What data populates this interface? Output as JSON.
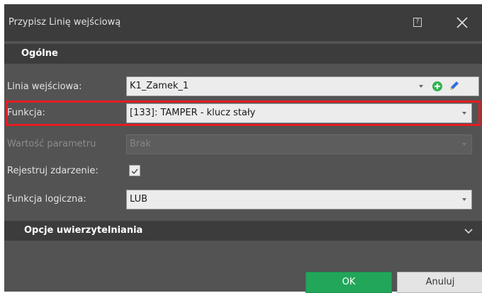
{
  "dialog": {
    "title": "Przypisz Linię wejściową",
    "help_glyph": "?"
  },
  "sections": {
    "general": "Ogólne",
    "auth_options": "Opcje uwierzytelniania"
  },
  "fields": {
    "input_line": {
      "label": "Linia wejściowa:",
      "value": "K1_Zamek_1"
    },
    "function": {
      "label": "Funkcja:",
      "value": "[133]: TAMPER - klucz stały"
    },
    "param_value": {
      "label": "Wartość parametru",
      "value": "Brak"
    },
    "log_event": {
      "label": "Rejestruj zdarzenie:",
      "checked": true
    },
    "logic_function": {
      "label": "Funkcja logiczna:",
      "value": "LUB"
    }
  },
  "buttons": {
    "ok": "OK",
    "cancel": "Anuluj"
  },
  "colors": {
    "highlight": "#e51c23",
    "ok_button": "#22a65a",
    "add_icon": "#2db34a",
    "edit_icon": "#2f6fe0"
  },
  "icons": {
    "add": "add-circle-icon",
    "edit": "pencil-icon",
    "close": "close-icon",
    "help": "help-icon",
    "dropdown": "chevron-down-icon"
  }
}
